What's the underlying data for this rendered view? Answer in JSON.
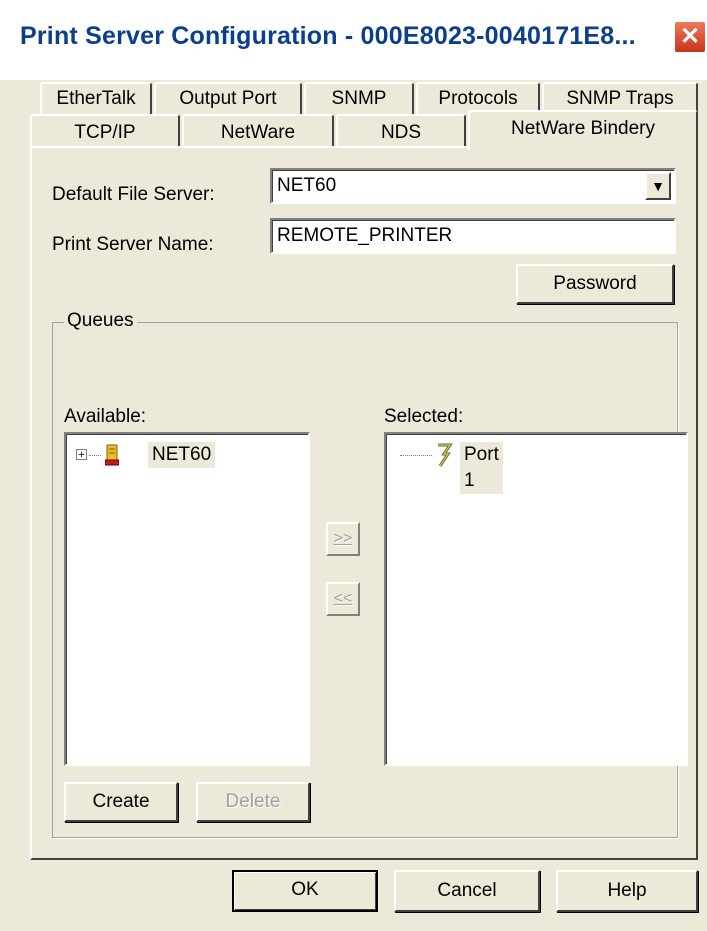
{
  "window": {
    "title": "Print Server Configuration - 000E8023-0040171E8...",
    "close_glyph": "✕"
  },
  "tabs": {
    "row1": [
      "EtherTalk",
      "Output Port",
      "SNMP",
      "Protocols",
      "SNMP Traps"
    ],
    "row2": [
      "TCP/IP",
      "NetWare",
      "NDS",
      "NetWare Bindery"
    ],
    "active": "NetWare Bindery"
  },
  "form": {
    "default_file_server_label": "Default File Server:",
    "default_file_server_value": "NET60",
    "print_server_name_label": "Print Server Name:",
    "print_server_name_value": "REMOTE_PRINTER",
    "password_button": "Password"
  },
  "queues": {
    "group_title": "Queues",
    "available_label": "Available:",
    "available_items": [
      {
        "label": "NET60",
        "icon": "server-icon",
        "expander": "+"
      }
    ],
    "selected_label": "Selected:",
    "selected_items": [
      {
        "label": "Port 1",
        "icon": "printer-port-icon"
      }
    ],
    "add_button": ">>",
    "remove_button": "<<",
    "create_button": "Create",
    "delete_button": "Delete"
  },
  "footer": {
    "ok": "OK",
    "cancel": "Cancel",
    "help": "Help"
  },
  "colors": {
    "dialog_bg": "#ece9d8",
    "title_text": "#0b3f8c",
    "close_button": "#d9482a"
  }
}
